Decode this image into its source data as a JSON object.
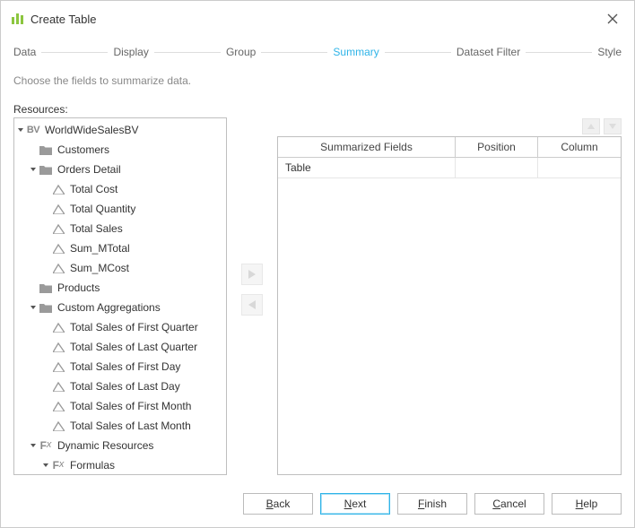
{
  "window": {
    "title": "Create Table"
  },
  "wizard": {
    "steps": [
      "Data",
      "Display",
      "Group",
      "Summary",
      "Dataset Filter",
      "Style"
    ],
    "active_index": 3
  },
  "instruction": "Choose the fields to summarize data.",
  "resources_label": "Resources:",
  "tree": {
    "root_label": "WorldWideSalesBV",
    "customers": "Customers",
    "orders_detail": "Orders Detail",
    "orders_children": [
      "Total Cost",
      "Total Quantity",
      "Total Sales",
      "Sum_MTotal",
      "Sum_MCost"
    ],
    "products": "Products",
    "custom_agg": "Custom Aggregations",
    "custom_agg_children": [
      "Total Sales of First Quarter",
      "Total Sales of Last Quarter",
      "Total Sales of First Day",
      "Total Sales of Last Day",
      "Total Sales of First Month",
      "Total Sales of Last Month"
    ],
    "dynamic_resources": "Dynamic Resources",
    "formulas": "Formulas"
  },
  "grid": {
    "headers": {
      "summarized": "Summarized Fields",
      "position": "Position",
      "column": "Column"
    },
    "rows": [
      {
        "summarized": "Table",
        "position": "",
        "column": ""
      }
    ]
  },
  "buttons": {
    "back": "Back",
    "next": "Next",
    "finish": "Finish",
    "cancel": "Cancel",
    "help": "Help"
  }
}
